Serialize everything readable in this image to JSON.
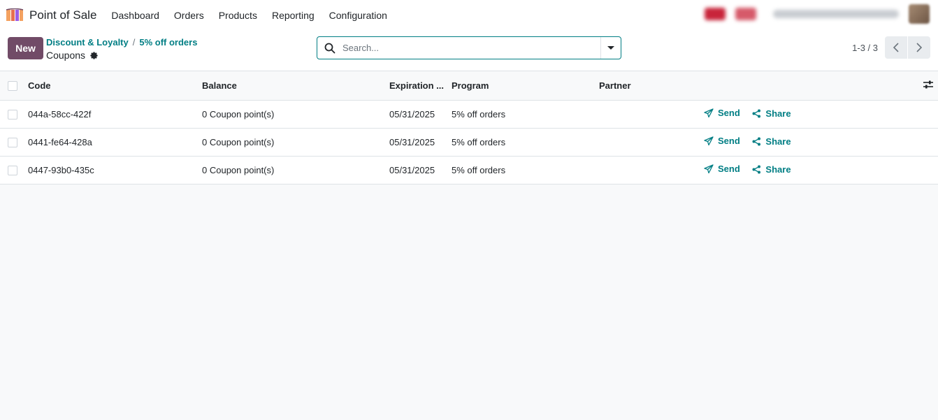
{
  "navbar": {
    "app_title": "Point of Sale",
    "menu": [
      "Dashboard",
      "Orders",
      "Products",
      "Reporting",
      "Configuration"
    ]
  },
  "control_panel": {
    "new_label": "New",
    "breadcrumbs": [
      "Discount & Loyalty",
      "5% off orders"
    ],
    "breadcrumb_separator": "/",
    "current_view": "Coupons",
    "search_placeholder": "Search...",
    "pager_value": "1-3 / 3"
  },
  "table": {
    "columns": [
      "Code",
      "Balance",
      "Expiration ...",
      "Program",
      "Partner"
    ],
    "send_label": "Send",
    "share_label": "Share",
    "rows": [
      {
        "code": "044a-58cc-422f",
        "balance": "0 Coupon point(s)",
        "expiration": "05/31/2025",
        "program": "5% off orders",
        "partner": ""
      },
      {
        "code": "0441-fe64-428a",
        "balance": "0 Coupon point(s)",
        "expiration": "05/31/2025",
        "program": "5% off orders",
        "partner": ""
      },
      {
        "code": "0447-93b0-435c",
        "balance": "0 Coupon point(s)",
        "expiration": "05/31/2025",
        "program": "5% off orders",
        "partner": ""
      }
    ]
  },
  "colors": {
    "brand": "#714b67",
    "link": "#017e84",
    "background": "#f8f9fa",
    "border": "#dee2e6"
  }
}
